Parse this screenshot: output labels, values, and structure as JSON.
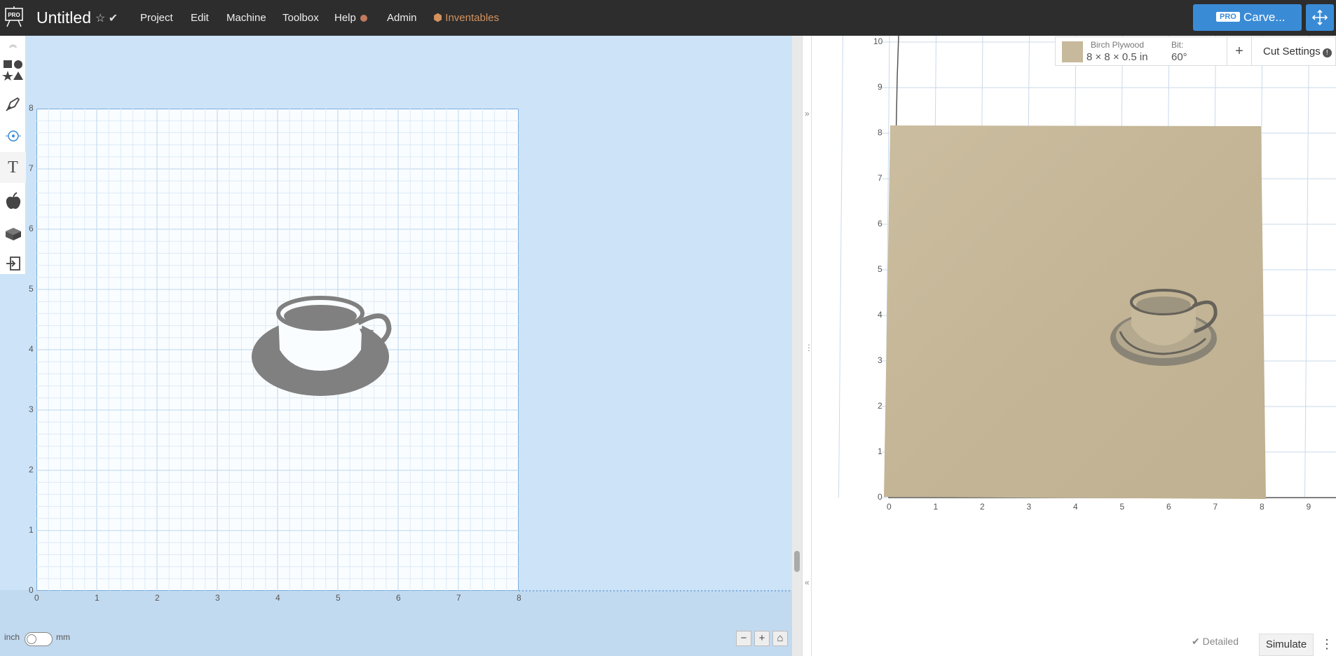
{
  "header": {
    "logo_badge": "PRO",
    "doc_title": "Untitled",
    "menu": [
      "Project",
      "Edit",
      "Machine",
      "Toolbox",
      "Help",
      "Admin",
      "Inventables"
    ],
    "carve_badge": "PRO",
    "carve_label": "Carve..."
  },
  "canvas": {
    "x_ticks": [
      "0",
      "1",
      "2",
      "3",
      "4",
      "5",
      "6",
      "7",
      "8"
    ],
    "y_ticks": [
      "0",
      "1",
      "2",
      "3",
      "4",
      "5",
      "6",
      "7",
      "8"
    ],
    "unit_left": "inch",
    "unit_right": "mm",
    "zoom_out": "−",
    "zoom_in": "+"
  },
  "material": {
    "name": "Birch Plywood",
    "dims": "8 × 8 × 0.5 in",
    "bit_label": "Bit:",
    "bit_value": "60°",
    "add": "+",
    "cut_settings": "Cut Settings",
    "warn": "!"
  },
  "preview": {
    "x_ticks": [
      "0",
      "1",
      "2",
      "3",
      "4",
      "5",
      "6",
      "7",
      "8",
      "9"
    ],
    "y_ticks": [
      "0",
      "1",
      "2",
      "3",
      "4",
      "5",
      "6",
      "7",
      "8",
      "9",
      "10"
    ],
    "detailed": "✔ Detailed",
    "simulate": "Simulate",
    "more": "⋮"
  },
  "colors": {
    "topbar": "#2d2d2d",
    "accent": "#3a8bd6",
    "canvas_bg": "#cce3f8",
    "wood": "#c7b99b"
  }
}
